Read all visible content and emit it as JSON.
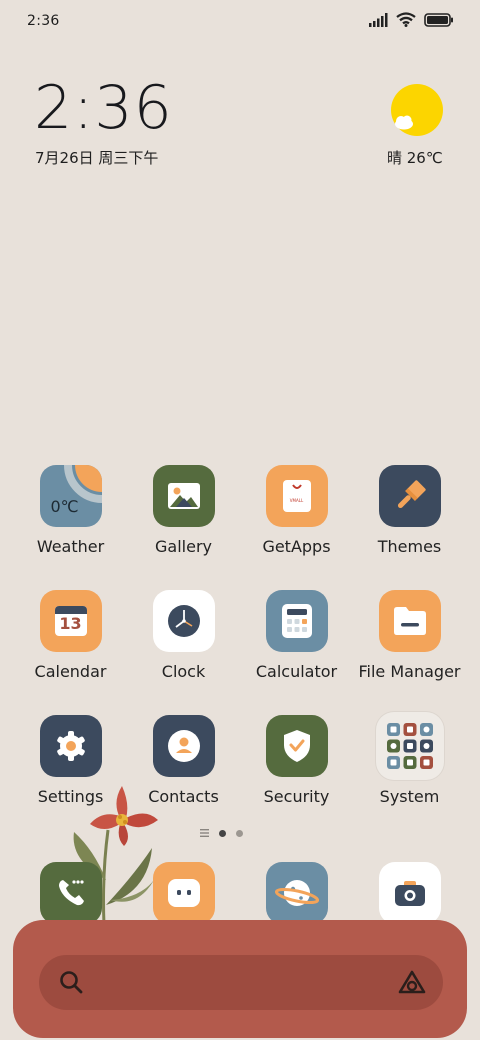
{
  "status_bar": {
    "time": "2:36"
  },
  "clock_widget": {
    "time": "2:36",
    "date": "7月26日 周三下午"
  },
  "weather_widget": {
    "text": "晴 26℃"
  },
  "apps": {
    "weather": {
      "label": "Weather",
      "temp": "0℃"
    },
    "gallery": {
      "label": "Gallery"
    },
    "getapps": {
      "label": "GetApps",
      "badge": "VMALL"
    },
    "themes": {
      "label": "Themes"
    },
    "calendar": {
      "label": "Calendar",
      "day": "13"
    },
    "clock": {
      "label": "Clock"
    },
    "calculator": {
      "label": "Calculator"
    },
    "file_manager": {
      "label": "File Manager"
    },
    "settings": {
      "label": "Settings"
    },
    "contacts": {
      "label": "Contacts"
    },
    "security": {
      "label": "Security"
    },
    "system": {
      "label": "System"
    }
  },
  "dock": [
    "phone-icon",
    "messages-icon",
    "browser-icon",
    "camera-icon"
  ],
  "colors": {
    "background": "#e8e1da",
    "dock_panel": "#b35a4c",
    "search_bar": "#9d4b3f",
    "green": "#556b3e",
    "orange": "#f3a45a",
    "slate": "#6b8ea4",
    "navy": "#3c4a5e",
    "sun": "#fcd500"
  }
}
